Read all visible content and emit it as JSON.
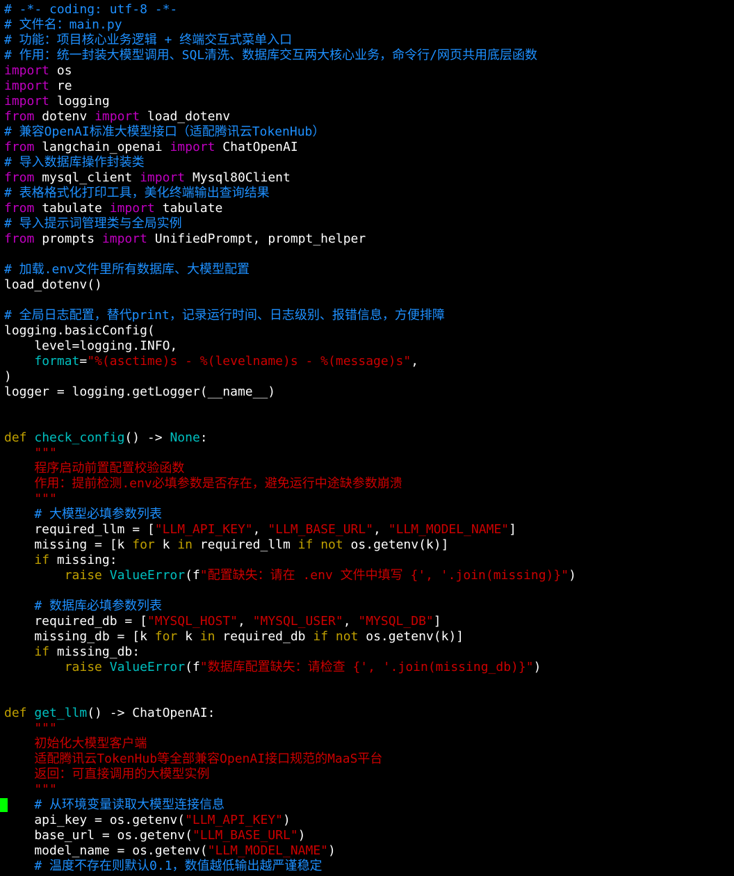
{
  "editor": {
    "file_name": "main.py",
    "colors": {
      "background": "#000000",
      "default": "#ffffff",
      "comment": "#1e90ff",
      "keyword": "#c000c0",
      "function": "#00c0c0",
      "string": "#cc0000",
      "def": "#c0a000",
      "cursor": "#00ff00"
    },
    "cursor_line": 52,
    "lines": [
      [
        {
          "t": "# -*- coding: utf-8 -*-",
          "c": "comment"
        }
      ],
      [
        {
          "t": "# 文件名：main.py",
          "c": "comment"
        }
      ],
      [
        {
          "t": "# 功能：项目核心业务逻辑 + 终端交互式菜单入口",
          "c": "comment"
        }
      ],
      [
        {
          "t": "# 作用：统一封装大模型调用、SQL清洗、数据库交互两大核心业务，命令行/网页共用底层函数",
          "c": "comment"
        }
      ],
      [
        {
          "t": "import",
          "c": "keyword"
        },
        {
          "t": " os",
          "c": "default"
        }
      ],
      [
        {
          "t": "import",
          "c": "keyword"
        },
        {
          "t": " re",
          "c": "default"
        }
      ],
      [
        {
          "t": "import",
          "c": "keyword"
        },
        {
          "t": " logging",
          "c": "default"
        }
      ],
      [
        {
          "t": "from",
          "c": "keyword"
        },
        {
          "t": " dotenv ",
          "c": "default"
        },
        {
          "t": "import",
          "c": "keyword"
        },
        {
          "t": " load_dotenv",
          "c": "default"
        }
      ],
      [
        {
          "t": "# 兼容OpenAI标准大模型接口（适配腾讯云TokenHub）",
          "c": "comment"
        }
      ],
      [
        {
          "t": "from",
          "c": "keyword"
        },
        {
          "t": " langchain_openai ",
          "c": "default"
        },
        {
          "t": "import",
          "c": "keyword"
        },
        {
          "t": " ChatOpenAI",
          "c": "default"
        }
      ],
      [
        {
          "t": "# 导入数据库操作封装类",
          "c": "comment"
        }
      ],
      [
        {
          "t": "from",
          "c": "keyword"
        },
        {
          "t": " mysql_client ",
          "c": "default"
        },
        {
          "t": "import",
          "c": "keyword"
        },
        {
          "t": " Mysql80Client",
          "c": "default"
        }
      ],
      [
        {
          "t": "# 表格格式化打印工具，美化终端输出查询结果",
          "c": "comment"
        }
      ],
      [
        {
          "t": "from",
          "c": "keyword"
        },
        {
          "t": " tabulate ",
          "c": "default"
        },
        {
          "t": "import",
          "c": "keyword"
        },
        {
          "t": " tabulate",
          "c": "default"
        }
      ],
      [
        {
          "t": "# 导入提示词管理类与全局实例",
          "c": "comment"
        }
      ],
      [
        {
          "t": "from",
          "c": "keyword"
        },
        {
          "t": " prompts ",
          "c": "default"
        },
        {
          "t": "import",
          "c": "keyword"
        },
        {
          "t": " UnifiedPrompt, prompt_helper",
          "c": "default"
        }
      ],
      [],
      [
        {
          "t": "# 加载.env文件里所有数据库、大模型配置",
          "c": "comment"
        }
      ],
      [
        {
          "t": "load_dotenv()",
          "c": "default"
        }
      ],
      [],
      [
        {
          "t": "# 全局日志配置，替代print，记录运行时间、日志级别、报错信息，方便排障",
          "c": "comment"
        }
      ],
      [
        {
          "t": "logging.basicConfig(",
          "c": "default"
        }
      ],
      [
        {
          "t": "    level=logging.INFO,",
          "c": "default"
        }
      ],
      [
        {
          "t": "    ",
          "c": "default"
        },
        {
          "t": "format",
          "c": "function"
        },
        {
          "t": "=",
          "c": "default"
        },
        {
          "t": "\"%(asctime)s - %(levelname)s - %(message)s\"",
          "c": "string"
        },
        {
          "t": ",",
          "c": "default"
        }
      ],
      [
        {
          "t": ")",
          "c": "default"
        }
      ],
      [
        {
          "t": "logger = logging.getLogger(__name__)",
          "c": "default"
        }
      ],
      [],
      [],
      [
        {
          "t": "def",
          "c": "def"
        },
        {
          "t": " ",
          "c": "default"
        },
        {
          "t": "check_config",
          "c": "function"
        },
        {
          "t": "() -> ",
          "c": "default"
        },
        {
          "t": "None",
          "c": "function"
        },
        {
          "t": ":",
          "c": "default"
        }
      ],
      [
        {
          "t": "    \"\"\"",
          "c": "string"
        }
      ],
      [
        {
          "t": "    程序启动前置配置校验函数",
          "c": "string"
        }
      ],
      [
        {
          "t": "    作用：提前检测.env必填参数是否存在，避免运行中途缺参数崩溃",
          "c": "string"
        }
      ],
      [
        {
          "t": "    \"\"\"",
          "c": "string"
        }
      ],
      [
        {
          "t": "    # 大模型必填参数列表",
          "c": "comment"
        }
      ],
      [
        {
          "t": "    required_llm = [",
          "c": "default"
        },
        {
          "t": "\"LLM_API_KEY\"",
          "c": "string"
        },
        {
          "t": ", ",
          "c": "default"
        },
        {
          "t": "\"LLM_BASE_URL\"",
          "c": "string"
        },
        {
          "t": ", ",
          "c": "default"
        },
        {
          "t": "\"LLM_MODEL_NAME\"",
          "c": "string"
        },
        {
          "t": "]",
          "c": "default"
        }
      ],
      [
        {
          "t": "    missing = [k ",
          "c": "default"
        },
        {
          "t": "for",
          "c": "def"
        },
        {
          "t": " k ",
          "c": "default"
        },
        {
          "t": "in",
          "c": "def"
        },
        {
          "t": " required_llm ",
          "c": "default"
        },
        {
          "t": "if",
          "c": "def"
        },
        {
          "t": " ",
          "c": "default"
        },
        {
          "t": "not",
          "c": "def"
        },
        {
          "t": " os.getenv(k)]",
          "c": "default"
        }
      ],
      [
        {
          "t": "    ",
          "c": "default"
        },
        {
          "t": "if",
          "c": "def"
        },
        {
          "t": " missing:",
          "c": "default"
        }
      ],
      [
        {
          "t": "        ",
          "c": "default"
        },
        {
          "t": "raise",
          "c": "def"
        },
        {
          "t": " ",
          "c": "default"
        },
        {
          "t": "ValueError",
          "c": "function"
        },
        {
          "t": "(f",
          "c": "default"
        },
        {
          "t": "\"配置缺失：请在 .env 文件中填写 {', '.join(missing)}\"",
          "c": "string"
        },
        {
          "t": ")",
          "c": "default"
        }
      ],
      [],
      [
        {
          "t": "    # 数据库必填参数列表",
          "c": "comment"
        }
      ],
      [
        {
          "t": "    required_db = [",
          "c": "default"
        },
        {
          "t": "\"MYSQL_HOST\"",
          "c": "string"
        },
        {
          "t": ", ",
          "c": "default"
        },
        {
          "t": "\"MYSQL_USER\"",
          "c": "string"
        },
        {
          "t": ", ",
          "c": "default"
        },
        {
          "t": "\"MYSQL_DB\"",
          "c": "string"
        },
        {
          "t": "]",
          "c": "default"
        }
      ],
      [
        {
          "t": "    missing_db = [k ",
          "c": "default"
        },
        {
          "t": "for",
          "c": "def"
        },
        {
          "t": " k ",
          "c": "default"
        },
        {
          "t": "in",
          "c": "def"
        },
        {
          "t": " required_db ",
          "c": "default"
        },
        {
          "t": "if",
          "c": "def"
        },
        {
          "t": " ",
          "c": "default"
        },
        {
          "t": "not",
          "c": "def"
        },
        {
          "t": " os.getenv(k)]",
          "c": "default"
        }
      ],
      [
        {
          "t": "    ",
          "c": "default"
        },
        {
          "t": "if",
          "c": "def"
        },
        {
          "t": " missing_db:",
          "c": "default"
        }
      ],
      [
        {
          "t": "        ",
          "c": "default"
        },
        {
          "t": "raise",
          "c": "def"
        },
        {
          "t": " ",
          "c": "default"
        },
        {
          "t": "ValueError",
          "c": "function"
        },
        {
          "t": "(f",
          "c": "default"
        },
        {
          "t": "\"数据库配置缺失：请检查 {', '.join(missing_db)}\"",
          "c": "string"
        },
        {
          "t": ")",
          "c": "default"
        }
      ],
      [],
      [],
      [
        {
          "t": "def",
          "c": "def"
        },
        {
          "t": " ",
          "c": "default"
        },
        {
          "t": "get_llm",
          "c": "function"
        },
        {
          "t": "() -> ChatOpenAI:",
          "c": "default"
        }
      ],
      [
        {
          "t": "    \"\"\"",
          "c": "string"
        }
      ],
      [
        {
          "t": "    初始化大模型客户端",
          "c": "string"
        }
      ],
      [
        {
          "t": "    适配腾讯云TokenHub等全部兼容OpenAI接口规范的MaaS平台",
          "c": "string"
        }
      ],
      [
        {
          "t": "    返回：可直接调用的大模型实例",
          "c": "string"
        }
      ],
      [
        {
          "t": "    \"\"\"",
          "c": "string"
        }
      ],
      [
        {
          "t": "    # 从环境变量读取大模型连接信息",
          "c": "comment"
        }
      ],
      [
        {
          "t": "    api_key = os.getenv(",
          "c": "default"
        },
        {
          "t": "\"LLM_API_KEY\"",
          "c": "string"
        },
        {
          "t": ")",
          "c": "default"
        }
      ],
      [
        {
          "t": "    base_url = os.getenv(",
          "c": "default"
        },
        {
          "t": "\"LLM_BASE_URL\"",
          "c": "string"
        },
        {
          "t": ")",
          "c": "default"
        }
      ],
      [
        {
          "t": "    model_name = os.getenv(",
          "c": "default"
        },
        {
          "t": "\"LLM_MODEL_NAME\"",
          "c": "string"
        },
        {
          "t": ")",
          "c": "default"
        }
      ],
      [
        {
          "t": "    # 温度不存在则默认0.1，数值越低输出越严谨稳定",
          "c": "comment"
        }
      ]
    ]
  }
}
